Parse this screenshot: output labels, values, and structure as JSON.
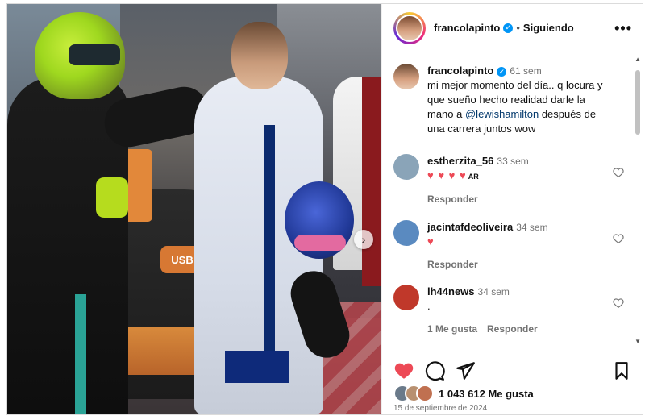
{
  "post": {
    "username": "francolapinto",
    "follow_status": "Siguiendo",
    "more_label": "•••",
    "caption": {
      "username": "francolapinto",
      "time": "61 sem",
      "text_before": "mi mejor momento del día.. q locura y que sueño hecho realidad darle la mano a ",
      "mention": "@lewishamilton",
      "text_after": " después de una carrera juntos wow"
    },
    "photo": {
      "badge_text": "USB"
    },
    "comments": [
      {
        "username": "estherzita_56",
        "time": "33 sem",
        "text": "♥ ♥ ♥ ♥",
        "extra": "AR",
        "actions": [
          "Responder"
        ],
        "avatar_color": "#8aa4b8"
      },
      {
        "username": "jacintafdeoliveira",
        "time": "34 sem",
        "text": "♥",
        "extra": "",
        "actions": [
          "Responder"
        ],
        "avatar_color": "#5a8ac0"
      },
      {
        "username": "lh44news",
        "time": "34 sem",
        "text": ".",
        "extra": "",
        "actions": [
          "1 Me gusta",
          "Responder"
        ],
        "avatar_color": "#c0382a"
      }
    ],
    "likes_count": "1 043 612 Me gusta",
    "date": "15 de septiembre de 2024",
    "colors": {
      "accent_blue": "#0095f6",
      "like_red": "#ed4956",
      "mention": "#00376b"
    },
    "icons": [
      "heart-filled-icon",
      "comment-icon",
      "share-icon",
      "bookmark-icon",
      "more-icon",
      "verified-icon",
      "chevron-right-icon"
    ]
  }
}
